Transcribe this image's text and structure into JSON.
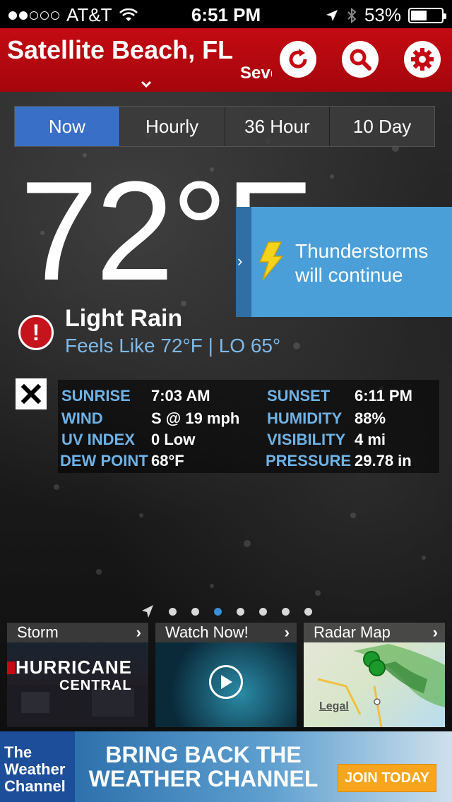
{
  "status_bar": {
    "carrier": "AT&T",
    "time": "6:51 PM",
    "battery": "53%",
    "battery_level": 0.53,
    "signal_bars_filled": 2,
    "signal_bars_total": 5
  },
  "header": {
    "location": "Satellite Beach, FL",
    "alert_text": "Severe"
  },
  "tabs": [
    {
      "label": "Now",
      "active": true
    },
    {
      "label": "Hourly",
      "active": false
    },
    {
      "label": "36 Hour",
      "active": false
    },
    {
      "label": "10 Day",
      "active": false
    }
  ],
  "current": {
    "temperature": "72°F",
    "condition": "Light Rain",
    "feels_like": "Feels Like 72°F",
    "separator": "|",
    "low": "LO 65°"
  },
  "forecast_popout": {
    "line1": "Thunderstorms",
    "line2": "will continue"
  },
  "details": {
    "sunrise_label": "SUNRISE",
    "sunrise": "7:03 AM",
    "sunset_label": "SUNSET",
    "sunset": "6:11 PM",
    "wind_label": "WIND",
    "wind": "S @ 19 mph",
    "humidity_label": "HUMIDITY",
    "humidity": "88%",
    "uv_label": "UV INDEX",
    "uv": "0 Low",
    "visibility_label": "VISIBILITY",
    "visibility": "4 mi",
    "dew_label": "DEW POINT",
    "dew": "68°F",
    "pressure_label": "PRESSURE",
    "pressure": "29.78 in"
  },
  "pager": {
    "count": 7,
    "active_index": 2
  },
  "tiles": {
    "storm": {
      "title": "Storm",
      "line1": "HURRICANE",
      "line2": "CENTRAL"
    },
    "watch": {
      "title": "Watch Now!"
    },
    "radar": {
      "title": "Radar Map",
      "legal": "Legal"
    }
  },
  "ad": {
    "logo": "The Weather Channel",
    "logo_line1": "The",
    "logo_line2": "Weather",
    "logo_line3": "Channel",
    "headline1": "BRING BACK THE",
    "headline2": "WEATHER CHANNEL",
    "button": "JOIN TODAY"
  },
  "colors": {
    "header_red": "#c40a12",
    "tab_active": "#3a6fc8",
    "detail_label": "#6fb2e6",
    "popout_blue": "#4a9fd8",
    "ad_button": "#f7a51c"
  }
}
